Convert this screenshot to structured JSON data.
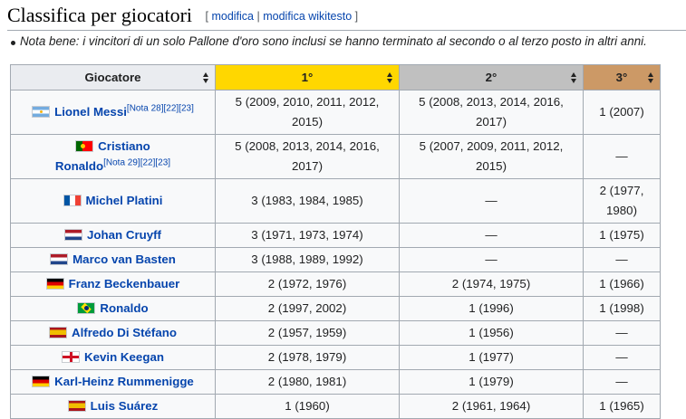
{
  "heading": {
    "title": "Classifica per giocatori",
    "open_bracket": "[",
    "edit": "modifica",
    "separator": "|",
    "edit_source": "modifica wikitesto",
    "close_bracket": "]"
  },
  "note": "Nota bene: i vincitori di un solo Pallone d'oro sono inclusi se hanno terminato al secondo o al terzo posto in altri anni.",
  "table": {
    "headers": [
      "Giocatore",
      "1°",
      "2°",
      "3°"
    ],
    "header_colors": {
      "first": "#ffd700",
      "second": "#c0c0c0",
      "third": "#cc9966"
    },
    "rows": [
      {
        "flag": "flag-argentina",
        "name": "Lionel Messi",
        "refs": "[Nota 28][22][23]",
        "first": "5 (2009, 2010, 2011, 2012, 2015)",
        "second": "5 (2008, 2013, 2014, 2016, 2017)",
        "third": "1 (2007)"
      },
      {
        "flag": "flag-portugal",
        "name": "Cristiano Ronaldo",
        "name_line1": "Cristiano",
        "name_line2": "Ronaldo",
        "refs": "[Nota 29][22][23]",
        "first": "5 (2008, 2013, 2014, 2016, 2017)",
        "second": "5 (2007, 2009, 2011, 2012, 2015)",
        "third": "—"
      },
      {
        "flag": "flag-france",
        "name": "Michel Platini",
        "first": "3 (1983, 1984, 1985)",
        "second": "—",
        "third": "2 (1977, 1980)"
      },
      {
        "flag": "flag-netherlands",
        "name": "Johan Cruyff",
        "first": "3 (1971, 1973, 1974)",
        "second": "—",
        "third": "1 (1975)"
      },
      {
        "flag": "flag-netherlands",
        "name": "Marco van Basten",
        "first": "3 (1988, 1989, 1992)",
        "second": "—",
        "third": "—"
      },
      {
        "flag": "flag-germany",
        "name": "Franz Beckenbauer",
        "first": "2 (1972, 1976)",
        "second": "2 (1974, 1975)",
        "third": "1 (1966)"
      },
      {
        "flag": "flag-brazil",
        "name": "Ronaldo",
        "first": "2 (1997, 2002)",
        "second": "1 (1996)",
        "third": "1 (1998)"
      },
      {
        "flag": "flag-spain",
        "name": "Alfredo Di Stéfano",
        "first": "2 (1957, 1959)",
        "second": "1 (1956)",
        "third": "—"
      },
      {
        "flag": "flag-england",
        "name": "Kevin Keegan",
        "first": "2 (1978, 1979)",
        "second": "1 (1977)",
        "third": "—"
      },
      {
        "flag": "flag-germany",
        "name": "Karl-Heinz Rummenigge",
        "first": "2 (1980, 1981)",
        "second": "1 (1979)",
        "third": "—"
      },
      {
        "flag": "flag-spain",
        "name": "Luis Suárez",
        "first": "1 (1960)",
        "second": "2 (1961, 1964)",
        "third": "1 (1965)"
      }
    ]
  }
}
